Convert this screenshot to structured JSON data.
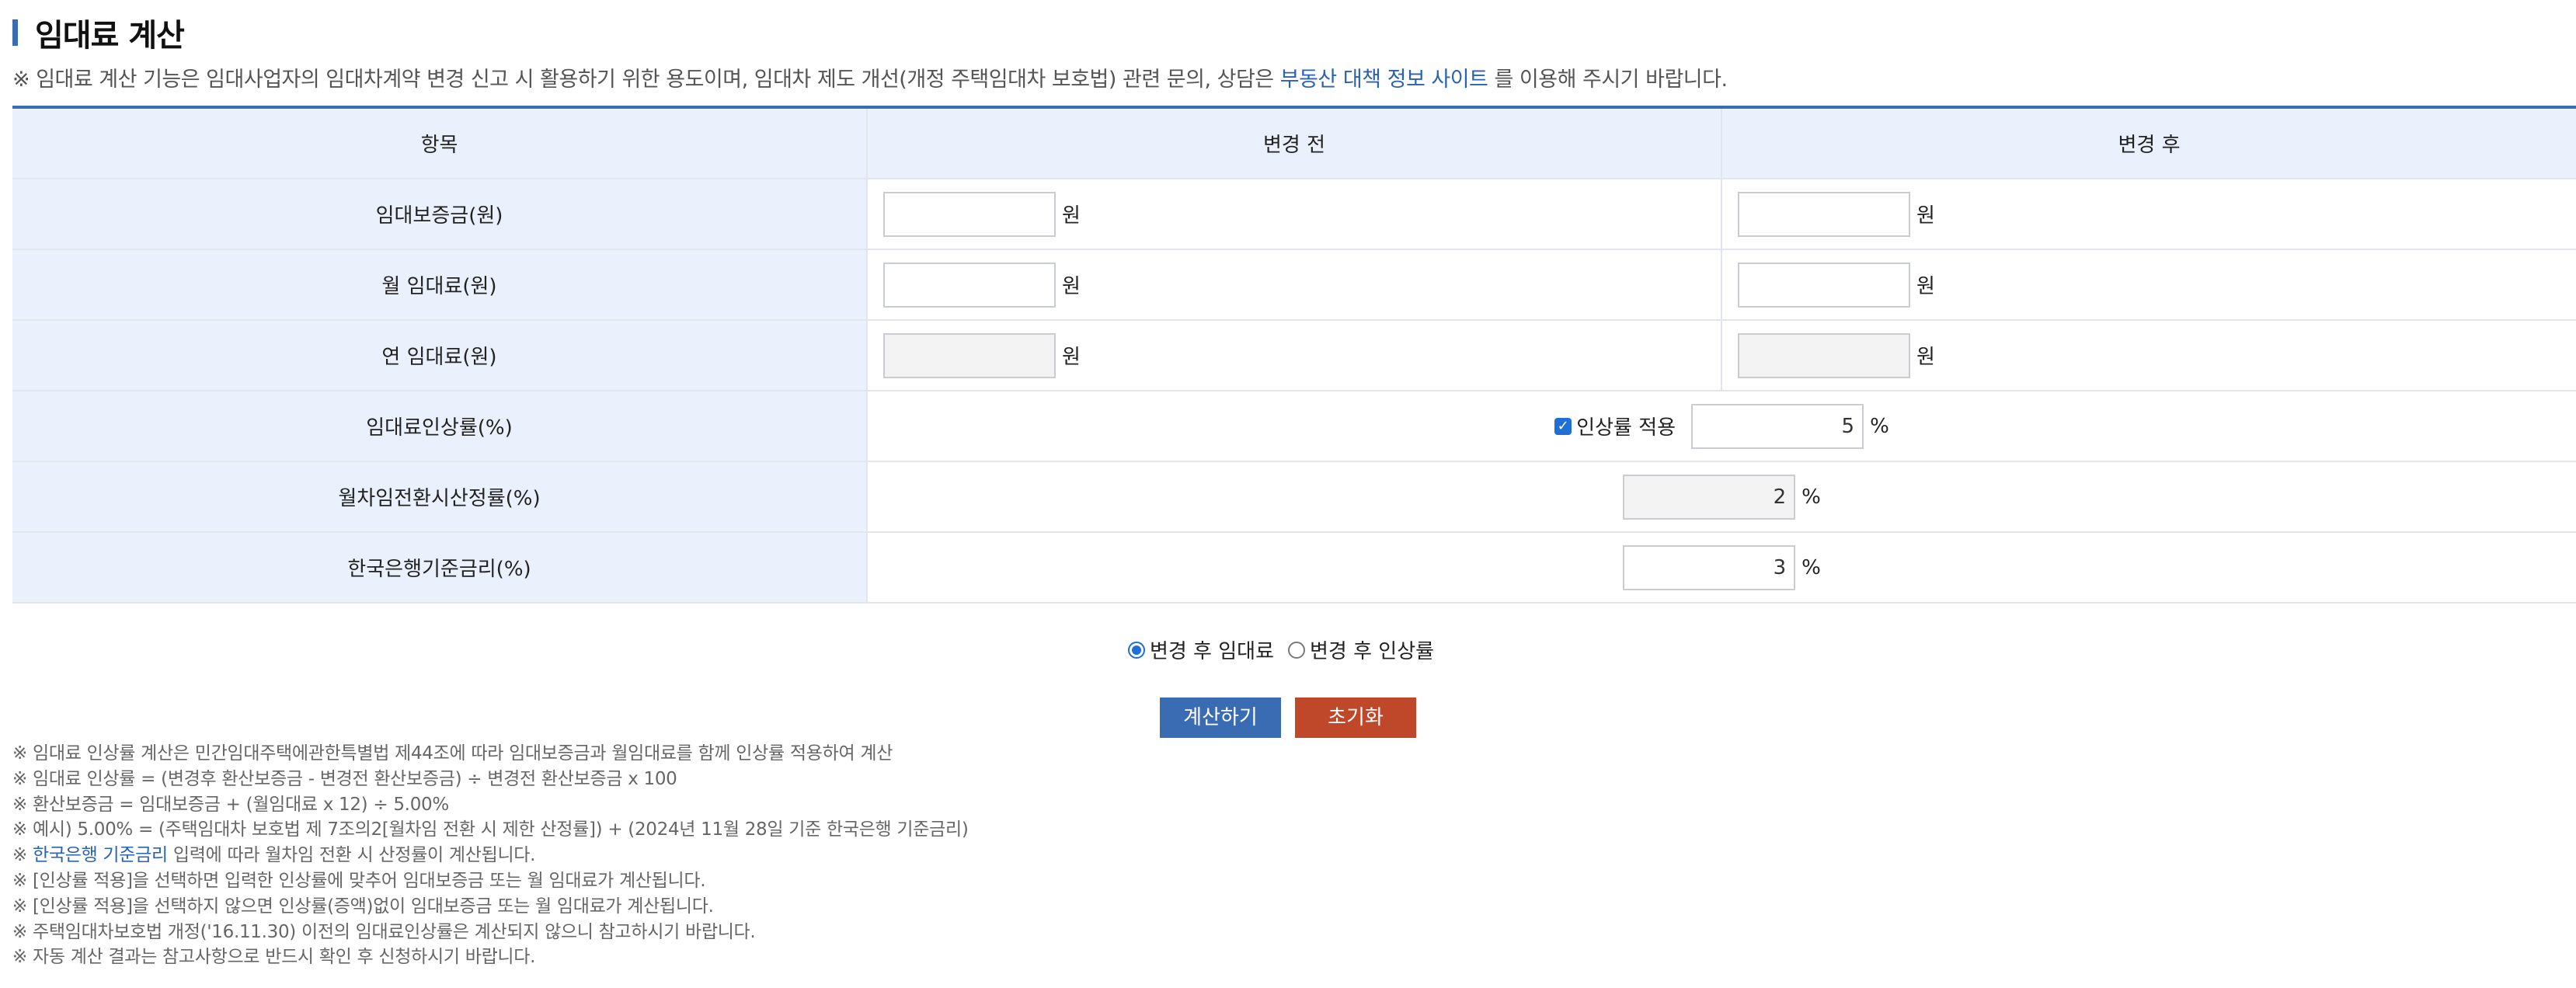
{
  "page": {
    "title": "임대료 계산",
    "notice_prefix": "※ 임대료 계산 기능은 임대사업자의 임대차계약 변경 신고 시 활용하기 위한 용도이며, 임대차 제도 개선(개정 주택임대차 보호법) 관련 문의, 상담은 ",
    "notice_link": "부동산 대책 정보 사이트",
    "notice_suffix": " 를 이용해 주시기 바랍니다."
  },
  "table": {
    "headers": {
      "item": "항목",
      "before": "변경 전",
      "after": "변경 후"
    },
    "unit_won": "원",
    "unit_pct": "%",
    "rows": {
      "deposit": {
        "label": "임대보증금(원)",
        "before": "",
        "after": ""
      },
      "monthly": {
        "label": "월 임대료(원)",
        "before": "",
        "after": ""
      },
      "annual": {
        "label": "연 임대료(원)",
        "before": "",
        "after": ""
      },
      "increase": {
        "label": "임대료인상률(%)",
        "checkbox_label": "인상률 적용",
        "checked": true,
        "value": "5"
      },
      "conversion": {
        "label": "월차임전환시산정률(%)",
        "value": "2"
      },
      "bok_rate": {
        "label": "한국은행기준금리(%)",
        "value": "3"
      }
    }
  },
  "calc_mode": {
    "options": [
      "변경 후 임대료",
      "변경 후 인상률"
    ],
    "selected": "변경 후 임대료"
  },
  "buttons": {
    "calculate": "계산하기",
    "reset": "초기화"
  },
  "notes": {
    "n1": "※  임대료 인상률 계산은 민간임대주택에관한특별법 제44조에 따라 임대보증금과 월임대료를 함께 인상률 적용하여 계산",
    "n2": "※  임대료 인상률 = (변경후 환산보증금 - 변경전 환산보증금) ÷ 변경전 환산보증금 x 100",
    "n3": "※  환산보증금 = 임대보증금 + (월임대료 x 12) ÷ 5.00%",
    "n4": "※  예시) 5.00% = (주택임대차 보호법 제 7조의2[월차임 전환 시 제한 산정률]) + (2024년 11월 28일 기준 한국은행 기준금리)",
    "n5_prefix": "※  ",
    "n5_link": "한국은행 기준금리",
    "n5_suffix": " 입력에 따라 월차임 전환 시 산정률이 계산됩니다.",
    "n6": "※  [인상률 적용]을 선택하면 입력한 인상률에 맞추어 임대보증금 또는 월 임대료가 계산됩니다.",
    "n7": "※  [인상률 적용]을 선택하지 않으면 인상률(증액)없이 임대보증금 또는 월 임대료가 계산됩니다.",
    "n8": "※  주택임대차보호법 개정('16.11.30) 이전의 임대료인상률은 계산되지 않으니 참고하시기 바랍니다.",
    "n9": "※  자동 계산 결과는 참고사항으로 반드시 확인 후 신청하시기 바랍니다."
  }
}
